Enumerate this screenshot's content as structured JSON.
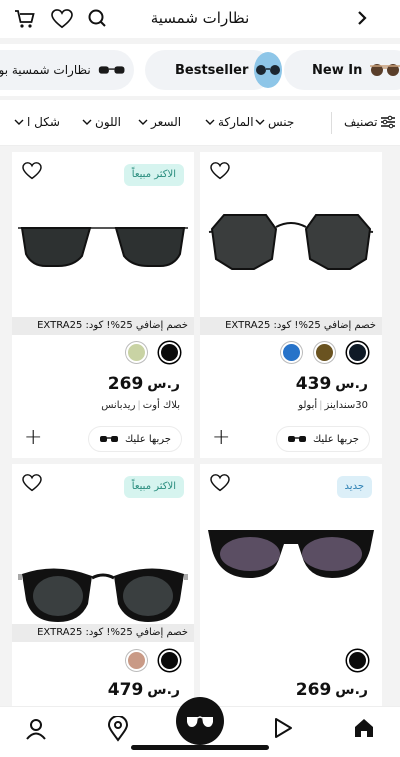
{
  "header": {
    "title": "نظارات شمسية"
  },
  "chips": [
    {
      "label": "New In"
    },
    {
      "label": "Bestseller"
    },
    {
      "label": "نظارات شمسية بوص"
    }
  ],
  "filters": {
    "sort": "تصنيف",
    "gender": "جنس",
    "brand": "الماركة",
    "price": "السعر",
    "color": "اللون",
    "shape": "شكل ا"
  },
  "promo_text": "خصم إضافي 25%! كود: EXTRA25",
  "tryon_label": "جربها عليك",
  "products": [
    {
      "badge": "",
      "price": "439",
      "name": "30سنداينز",
      "brand": "أبولو",
      "swatches": [
        "#0f1a26",
        "#6a5320",
        "#2773c9"
      ]
    },
    {
      "badge": "الاكثر مبيعاً",
      "price": "269",
      "name": "بلاك أوت",
      "brand": "ريدبانس",
      "swatches": [
        "#0b0b0b",
        "#c9d3a4"
      ]
    },
    {
      "badge": "جديد",
      "price": "269",
      "swatches": [
        "#0b0b0b"
      ]
    },
    {
      "badge": "الاكثر مبيعاً",
      "price": "479",
      "swatches": [
        "#0b0b0b",
        "#c99a86"
      ]
    }
  ],
  "colors": {
    "accent": "#2a8d7e",
    "badge_bg": "#d6f4ef",
    "new_badge_bg": "#dceff8",
    "new_badge_text": "#2b7fb3"
  }
}
